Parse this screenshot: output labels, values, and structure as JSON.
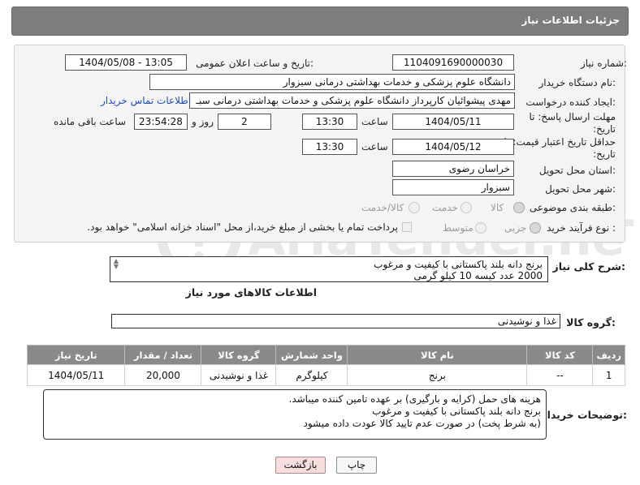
{
  "header": {
    "title": "جزئیات اطلاعات نیاز"
  },
  "labels": {
    "need_number": "شماره نیاز:",
    "announce_datetime": "تاریخ و ساعت اعلان عمومی:",
    "buyer_org": "نام دستگاه خریدار:",
    "requester": "ایجاد کننده درخواست:",
    "reply_deadline": "مهلت ارسال پاسخ: تا تاریخ:",
    "price_validity": "حداقل تاریخ اعتبار قیمت: تا تاریخ:",
    "time": "ساعت",
    "day_and": "روز و",
    "remaining_time": "ساعت باقی مانده",
    "delivery_province": "استان محل تحویل:",
    "delivery_city": "شهر محل تحویل:",
    "category": "طبقه بندی موضوعی:",
    "purchase_type": "نوع فرآیند خرید :",
    "general_desc": "شرح کلی نیاز:",
    "goods_info": "اطلاعات کالاهای مورد نیاز",
    "goods_group": "گروه کالا:",
    "buyer_notes": "توضیحات خریدار:"
  },
  "fields": {
    "need_number": "1104091690000030",
    "announce_datetime": "1404/05/08 - 13:05",
    "buyer_org": "دانشگاه علوم پزشکی و خدمات بهداشتی  درمانی سبزوار",
    "requester": "مهدی پیشوائیان کارپرداز دانشگاه علوم پزشکی و خدمات بهداشتی  درمانی سبـ",
    "contact_link": "اطلاعات تماس خریدار",
    "reply_date": "1404/05/11",
    "reply_time": "13:30",
    "days": "2",
    "remaining": "23:54:28",
    "validity_date": "1404/05/12",
    "validity_time": "13:30",
    "province": "خراسان رضوی",
    "city": "سبزوار",
    "goods_group": "غذا و نوشیدنی"
  },
  "category_options": [
    {
      "label": "کالا",
      "checked": true
    },
    {
      "label": "خدمت",
      "checked": false
    },
    {
      "label": "کالا/خدمت",
      "checked": false
    }
  ],
  "purchase_options": [
    {
      "label": "جزیی",
      "checked": true
    },
    {
      "label": "متوسط",
      "checked": false
    }
  ],
  "payment_note": "پرداخت تمام یا بخشی از مبلغ خرید،از محل \"اسناد خزانه اسلامی\" خواهد بود.",
  "general_desc_lines": [
    "برنج دانه بلند پاکستانی با کیفیت و مرغوب",
    "2000 عدد کیسه 10 کیلو گرمی"
  ],
  "table": {
    "headers": [
      "ردیف",
      "کد کالا",
      "نام کالا",
      "واحد شمارش",
      "گروه کالا",
      "تعداد / مقدار",
      "تاریخ نیاز"
    ],
    "rows": [
      [
        "1",
        "--",
        "برنج",
        "کیلوگرم",
        "غذا و نوشیدنی",
        "20,000",
        "1404/05/11"
      ]
    ]
  },
  "buyer_notes_lines": [
    "هزینه های حمل (کرایه و بارگیری) بر عهده تامین کننده میباشد.",
    "برنج دانه بلند پاکستانی با کیفیت و مرغوب",
    "(به شرط پخت) در صورت عدم تایید کالا عودت داده میشود"
  ],
  "buttons": {
    "print": "چاپ",
    "back": "بازگشت"
  },
  "watermark": {
    "text": "AriaTender.neT"
  },
  "colors": {
    "header_bg": "#7d7d7d",
    "link": "#1e4fb4",
    "back_button": "#f6dede"
  }
}
